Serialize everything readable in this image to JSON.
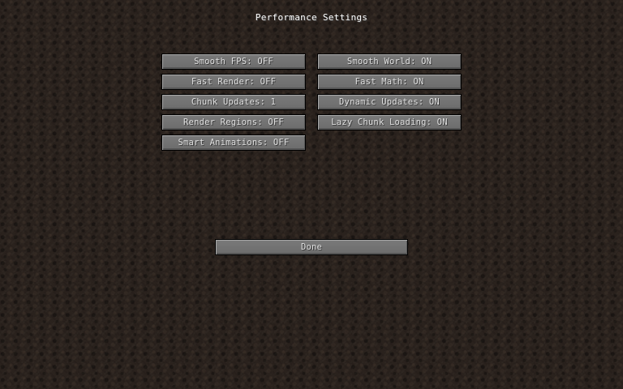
{
  "screen": {
    "title": "Performance Settings"
  },
  "options": {
    "left": [
      {
        "label": "Smooth FPS: OFF"
      },
      {
        "label": "Fast Render: OFF"
      },
      {
        "label": "Chunk Updates: 1"
      },
      {
        "label": "Render Regions: OFF"
      },
      {
        "label": "Smart Animations: OFF"
      }
    ],
    "right": [
      {
        "label": "Smooth World: ON"
      },
      {
        "label": "Fast Math: ON"
      },
      {
        "label": "Dynamic Updates: ON"
      },
      {
        "label": "Lazy Chunk Loading: ON"
      }
    ]
  },
  "done": {
    "label": "Done"
  }
}
